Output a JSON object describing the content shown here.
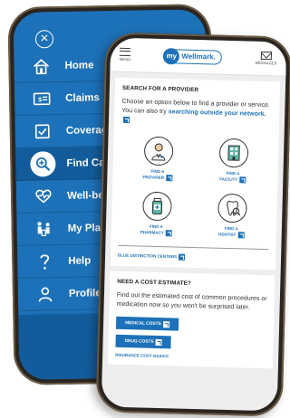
{
  "menu": {
    "close_icon": "close-circle-icon",
    "items": [
      {
        "label": "Home",
        "icon": "house-icon",
        "active": false
      },
      {
        "label": "Claims",
        "icon": "claims-icon",
        "active": false
      },
      {
        "label": "Coverage",
        "icon": "coverage-icon",
        "active": false
      },
      {
        "label": "Find Care",
        "icon": "find-care-icon",
        "active": true
      },
      {
        "label": "Well-being",
        "icon": "heart-icon",
        "active": false
      },
      {
        "label": "My Plans",
        "icon": "my-plans-icon",
        "active": false
      },
      {
        "label": "Help",
        "icon": "question-icon",
        "active": false
      },
      {
        "label": "Profile",
        "icon": "person-icon",
        "active": false
      }
    ]
  },
  "topbar": {
    "menu_label": "MENU",
    "logo_my": "my",
    "logo_brand": "Wellmark.",
    "messages_label": "MESSAGES"
  },
  "search_provider": {
    "heading": "SEARCH FOR A PROVIDER",
    "intro": "Choose an option below to find a provider or service. You can also try",
    "intro_link": "searching outside your network.",
    "options": [
      {
        "line1": "FIND A",
        "line2": "PROVIDER",
        "icon": "doctor-icon"
      },
      {
        "line1": "FIND A",
        "line2": "FACILITY",
        "icon": "facility-icon"
      },
      {
        "line1": "FIND A",
        "line2": "PHARMACY",
        "icon": "pharmacy-icon"
      },
      {
        "line1": "FIND A",
        "line2": "DENTIST",
        "icon": "dentist-icon"
      }
    ],
    "blue_distinction": "BLUE DISTINCTION CENTERS"
  },
  "cost_estimate": {
    "heading": "NEED A COST ESTIMATE?",
    "body": "Find out the estimated cost of common procedures or medication now so you won't be surprised later.",
    "medical_button": "MEDICAL COSTS",
    "drug_button": "DRUG COSTS",
    "basics_link": "INSURANCE COST BASICS"
  },
  "colors": {
    "brand_blue": "#1d71b8",
    "menu_active": "#135c9b",
    "phone_frame": "#2a2520"
  }
}
